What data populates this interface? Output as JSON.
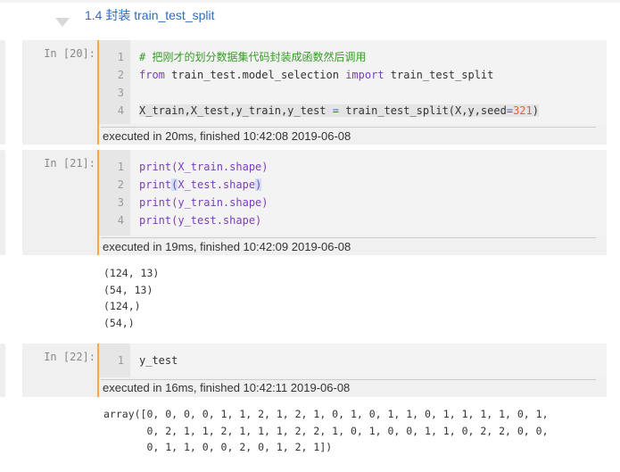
{
  "heading": "1.4  封装 train_test_split",
  "cells": [
    {
      "prompt": "In [20]:",
      "lines": [
        {
          "n": "1",
          "parts": [
            "# 把刚才的划分数据集代码封装成函数然后调用"
          ]
        },
        {
          "n": "2",
          "parts": [
            "from",
            " train_test.model_selection ",
            "import",
            " train_test_split"
          ]
        },
        {
          "n": "3",
          "parts": []
        },
        {
          "n": "4",
          "parts": [
            "X_train,X_test,y_train,y_test ",
            "=",
            " train_test_split(X,y,seed",
            "=",
            "321",
            ")"
          ]
        }
      ],
      "exec": "executed in 20ms, finished 10:42:08 2019-06-08"
    },
    {
      "prompt": "In [21]:",
      "lines": [
        {
          "n": "1",
          "parts": [
            "print(X_train.shape)"
          ]
        },
        {
          "n": "2",
          "parts": [
            "print",
            "(",
            "X_test.shape",
            ")"
          ]
        },
        {
          "n": "3",
          "parts": [
            "print(y_train.shape)"
          ]
        },
        {
          "n": "4",
          "parts": [
            "print(y_test.shape)"
          ]
        }
      ],
      "exec": "executed in 19ms, finished 10:42:09 2019-06-08",
      "output": "(124, 13)\n(54, 13)\n(124,)\n(54,)"
    },
    {
      "prompt": "In [22]:",
      "lines": [
        {
          "n": "1",
          "parts": [
            "y_test"
          ]
        }
      ],
      "exec": "executed in 16ms, finished 10:42:11 2019-06-08",
      "output": "array([0, 0, 0, 0, 1, 1, 2, 1, 2, 1, 0, 1, 0, 1, 1, 0, 1, 1, 1, 1, 0, 1,\n       0, 2, 1, 1, 2, 1, 1, 1, 2, 2, 1, 0, 1, 0, 0, 1, 1, 0, 2, 2, 0, 0,\n       0, 1, 1, 0, 0, 2, 0, 1, 2, 1])"
    }
  ]
}
